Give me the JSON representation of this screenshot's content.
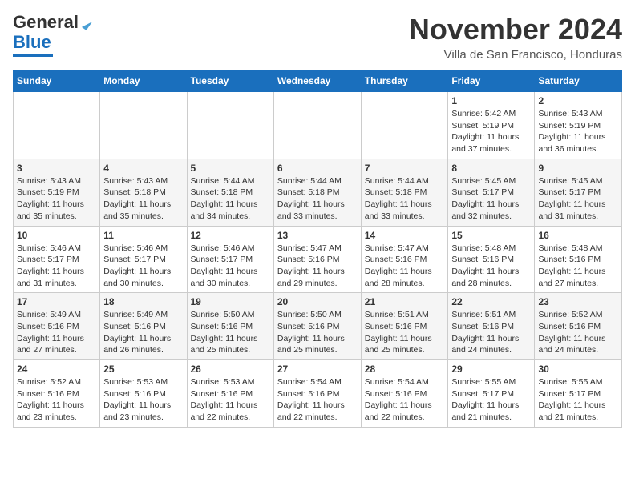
{
  "header": {
    "logo_line1": "General",
    "logo_line2": "Blue",
    "month": "November 2024",
    "location": "Villa de San Francisco, Honduras"
  },
  "weekdays": [
    "Sunday",
    "Monday",
    "Tuesday",
    "Wednesday",
    "Thursday",
    "Friday",
    "Saturday"
  ],
  "weeks": [
    [
      {
        "day": "",
        "info": ""
      },
      {
        "day": "",
        "info": ""
      },
      {
        "day": "",
        "info": ""
      },
      {
        "day": "",
        "info": ""
      },
      {
        "day": "",
        "info": ""
      },
      {
        "day": "1",
        "info": "Sunrise: 5:42 AM\nSunset: 5:19 PM\nDaylight: 11 hours\nand 37 minutes."
      },
      {
        "day": "2",
        "info": "Sunrise: 5:43 AM\nSunset: 5:19 PM\nDaylight: 11 hours\nand 36 minutes."
      }
    ],
    [
      {
        "day": "3",
        "info": "Sunrise: 5:43 AM\nSunset: 5:19 PM\nDaylight: 11 hours\nand 35 minutes."
      },
      {
        "day": "4",
        "info": "Sunrise: 5:43 AM\nSunset: 5:18 PM\nDaylight: 11 hours\nand 35 minutes."
      },
      {
        "day": "5",
        "info": "Sunrise: 5:44 AM\nSunset: 5:18 PM\nDaylight: 11 hours\nand 34 minutes."
      },
      {
        "day": "6",
        "info": "Sunrise: 5:44 AM\nSunset: 5:18 PM\nDaylight: 11 hours\nand 33 minutes."
      },
      {
        "day": "7",
        "info": "Sunrise: 5:44 AM\nSunset: 5:18 PM\nDaylight: 11 hours\nand 33 minutes."
      },
      {
        "day": "8",
        "info": "Sunrise: 5:45 AM\nSunset: 5:17 PM\nDaylight: 11 hours\nand 32 minutes."
      },
      {
        "day": "9",
        "info": "Sunrise: 5:45 AM\nSunset: 5:17 PM\nDaylight: 11 hours\nand 31 minutes."
      }
    ],
    [
      {
        "day": "10",
        "info": "Sunrise: 5:46 AM\nSunset: 5:17 PM\nDaylight: 11 hours\nand 31 minutes."
      },
      {
        "day": "11",
        "info": "Sunrise: 5:46 AM\nSunset: 5:17 PM\nDaylight: 11 hours\nand 30 minutes."
      },
      {
        "day": "12",
        "info": "Sunrise: 5:46 AM\nSunset: 5:17 PM\nDaylight: 11 hours\nand 30 minutes."
      },
      {
        "day": "13",
        "info": "Sunrise: 5:47 AM\nSunset: 5:16 PM\nDaylight: 11 hours\nand 29 minutes."
      },
      {
        "day": "14",
        "info": "Sunrise: 5:47 AM\nSunset: 5:16 PM\nDaylight: 11 hours\nand 28 minutes."
      },
      {
        "day": "15",
        "info": "Sunrise: 5:48 AM\nSunset: 5:16 PM\nDaylight: 11 hours\nand 28 minutes."
      },
      {
        "day": "16",
        "info": "Sunrise: 5:48 AM\nSunset: 5:16 PM\nDaylight: 11 hours\nand 27 minutes."
      }
    ],
    [
      {
        "day": "17",
        "info": "Sunrise: 5:49 AM\nSunset: 5:16 PM\nDaylight: 11 hours\nand 27 minutes."
      },
      {
        "day": "18",
        "info": "Sunrise: 5:49 AM\nSunset: 5:16 PM\nDaylight: 11 hours\nand 26 minutes."
      },
      {
        "day": "19",
        "info": "Sunrise: 5:50 AM\nSunset: 5:16 PM\nDaylight: 11 hours\nand 25 minutes."
      },
      {
        "day": "20",
        "info": "Sunrise: 5:50 AM\nSunset: 5:16 PM\nDaylight: 11 hours\nand 25 minutes."
      },
      {
        "day": "21",
        "info": "Sunrise: 5:51 AM\nSunset: 5:16 PM\nDaylight: 11 hours\nand 25 minutes."
      },
      {
        "day": "22",
        "info": "Sunrise: 5:51 AM\nSunset: 5:16 PM\nDaylight: 11 hours\nand 24 minutes."
      },
      {
        "day": "23",
        "info": "Sunrise: 5:52 AM\nSunset: 5:16 PM\nDaylight: 11 hours\nand 24 minutes."
      }
    ],
    [
      {
        "day": "24",
        "info": "Sunrise: 5:52 AM\nSunset: 5:16 PM\nDaylight: 11 hours\nand 23 minutes."
      },
      {
        "day": "25",
        "info": "Sunrise: 5:53 AM\nSunset: 5:16 PM\nDaylight: 11 hours\nand 23 minutes."
      },
      {
        "day": "26",
        "info": "Sunrise: 5:53 AM\nSunset: 5:16 PM\nDaylight: 11 hours\nand 22 minutes."
      },
      {
        "day": "27",
        "info": "Sunrise: 5:54 AM\nSunset: 5:16 PM\nDaylight: 11 hours\nand 22 minutes."
      },
      {
        "day": "28",
        "info": "Sunrise: 5:54 AM\nSunset: 5:16 PM\nDaylight: 11 hours\nand 22 minutes."
      },
      {
        "day": "29",
        "info": "Sunrise: 5:55 AM\nSunset: 5:17 PM\nDaylight: 11 hours\nand 21 minutes."
      },
      {
        "day": "30",
        "info": "Sunrise: 5:55 AM\nSunset: 5:17 PM\nDaylight: 11 hours\nand 21 minutes."
      }
    ]
  ]
}
